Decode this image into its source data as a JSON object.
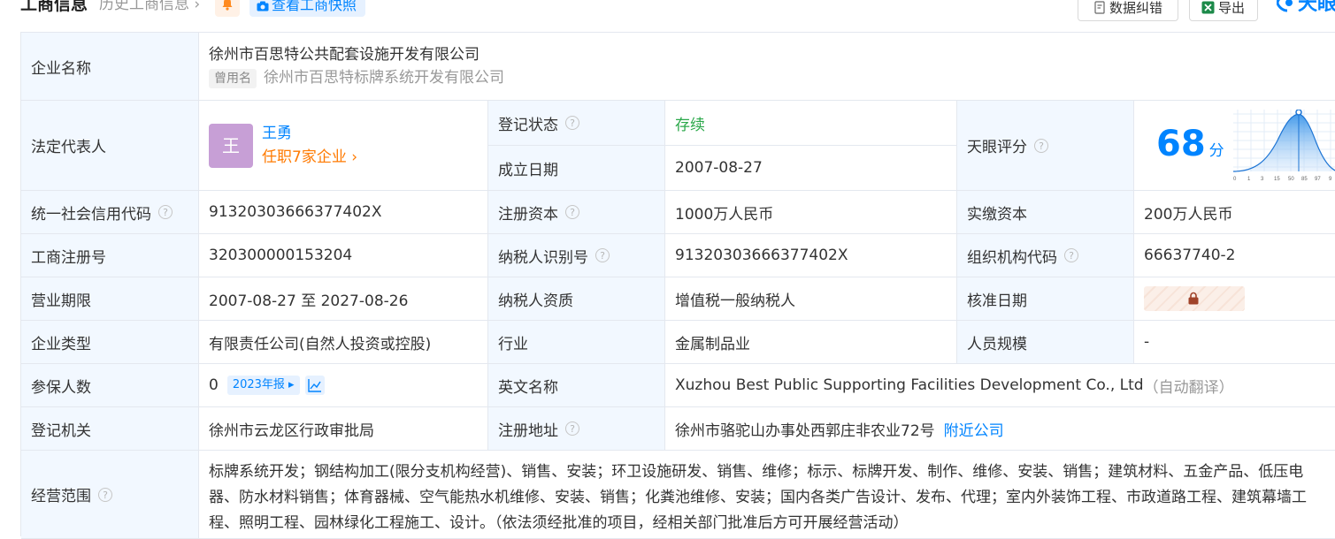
{
  "header": {
    "title": "工商信息",
    "history_link": "历史工商信息",
    "snapshot_button": "查看工商快照",
    "correct_button": "数据纠错",
    "export_button": "导出",
    "brand": "天眼"
  },
  "company": {
    "name_label": "企业名称",
    "name": "徐州市百思特公共配套设施开发有限公司",
    "former_tag": "曾用名",
    "former_name": "徐州市百思特标牌系统开发有限公司"
  },
  "legal_rep": {
    "label": "法定代表人",
    "avatar_char": "王",
    "name": "王勇",
    "positions": "任职7家企业"
  },
  "reg_status": {
    "label": "登记状态",
    "value": "存续"
  },
  "found_date": {
    "label": "成立日期",
    "value": "2007-08-27"
  },
  "score": {
    "label": "天眼评分",
    "value": "68",
    "unit": "分",
    "axis_ticks": [
      "0",
      "1",
      "3",
      "15",
      "50",
      "85",
      "97",
      "9"
    ]
  },
  "credit_code": {
    "label": "统一社会信用代码",
    "value": "91320303666377402X"
  },
  "reg_capital": {
    "label": "注册资本",
    "value": "1000万人民币"
  },
  "paid_capital": {
    "label": "实缴资本",
    "value": "200万人民币"
  },
  "reg_no": {
    "label": "工商注册号",
    "value": "320300000153204"
  },
  "taxpayer_id": {
    "label": "纳税人识别号",
    "value": "91320303666377402X"
  },
  "org_code": {
    "label": "组织机构代码",
    "value": "66637740-2"
  },
  "term": {
    "label": "营业期限",
    "value": "2007-08-27 至 2027-08-26"
  },
  "taxpayer_type": {
    "label": "纳税人资质",
    "value": "增值税一般纳税人"
  },
  "approve_date": {
    "label": "核准日期"
  },
  "company_type": {
    "label": "企业类型",
    "value": "有限责任公司(自然人投资或控股)"
  },
  "industry": {
    "label": "行业",
    "value": "金属制品业"
  },
  "staff_size": {
    "label": "人员规模",
    "value": "-"
  },
  "insured": {
    "label": "参保人数",
    "value": "0",
    "report_tag": "2023年报"
  },
  "english_name": {
    "label": "英文名称",
    "value": "Xuzhou Best Public Supporting Facilities Development Co., Ltd",
    "note": "（自动翻译）"
  },
  "authority": {
    "label": "登记机关",
    "value": "徐州市云龙区行政审批局"
  },
  "address": {
    "label": "注册地址",
    "value": "徐州市骆驼山办事处西郭庄非农业72号",
    "nearby": "附近公司"
  },
  "scope": {
    "label": "经营范围",
    "lines": [
      "标牌系统开发；钢结构加工(限分支机构经营)、销售、安装；环卫设施研发、销售、维修；标示、标牌开发、制作、维修、安装、销售；建筑材料、五金产品、低压电",
      "器、防水材料销售；体育器械、空气能热水机维修、安装、销售；化粪池维修、安装；国内各类广告设计、发布、代理；室内外装饰工程、市政道路工程、建筑幕墙工",
      "程、照明工程、园林绿化工程施工、设计。（依法须经批准的项目，经相关部门批准后方可开展经营活动）"
    ]
  },
  "colors": {
    "accent": "#0084ff",
    "label_bg": "#f2f8ff",
    "status_green": "#2ba84a",
    "link_orange": "#ff7a00"
  }
}
